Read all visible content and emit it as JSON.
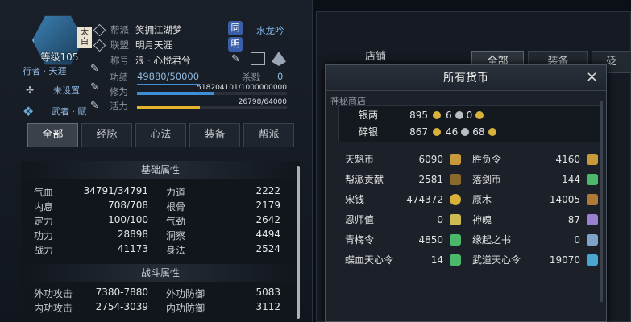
{
  "character": {
    "level": "等级105",
    "badge": "太白",
    "rows": [
      {
        "key": "帮派",
        "value": "笑拥江湖梦"
      },
      {
        "key": "联盟",
        "value": "明月天涯"
      },
      {
        "key": "称号",
        "value": "浪 · 心悦君兮"
      }
    ],
    "side_tags": [
      "同",
      "明"
    ],
    "side_text": "水龙吟",
    "roles": [
      {
        "label": "行者 · 天涯"
      },
      {
        "label": "未设置"
      },
      {
        "label": "武者 · 赋"
      }
    ],
    "stats": [
      {
        "key": "功绩",
        "value": "49880/50000",
        "extra_key": "杀戮",
        "extra": "0",
        "fill": 0.998
      },
      {
        "key": "修为",
        "value": "518204101/1000000000",
        "fill": 0.518
      },
      {
        "key": "活力",
        "value": "26798/64000",
        "fill": 0.419
      }
    ]
  },
  "tabs": [
    "全部",
    "经脉",
    "心法",
    "装备",
    "帮派"
  ],
  "sections": {
    "basic": {
      "title": "基础属性",
      "rows": [
        {
          "k1": "气血",
          "v1": "34791/34791",
          "k2": "力道",
          "v2": "2222"
        },
        {
          "k1": "内息",
          "v1": "708/708",
          "k2": "根骨",
          "v2": "2179"
        },
        {
          "k1": "定力",
          "v1": "100/100",
          "k2": "气劲",
          "v2": "2642"
        },
        {
          "k1": "功力",
          "v1": "28898",
          "k2": "洞察",
          "v2": "4494"
        },
        {
          "k1": "战力",
          "v1": "41173",
          "k2": "身法",
          "v2": "2524"
        }
      ]
    },
    "combat": {
      "title": "战斗属性",
      "rows": [
        {
          "k1": "外功攻击",
          "v1": "7380-7880",
          "k2": "外功防御",
          "v2": "5083"
        },
        {
          "k1": "内功攻击",
          "v1": "2754-3039",
          "k2": "内功防御",
          "v2": "3112"
        }
      ]
    }
  },
  "background": {
    "shop_label": "店铺",
    "tabs": [
      "全部",
      "装备",
      "砭"
    ],
    "sub": "神秘商店"
  },
  "dialog": {
    "title": "所有货币",
    "close": "×",
    "silver": {
      "label": "银两",
      "a": "895",
      "b": "6",
      "c": "0"
    },
    "broken_silver": {
      "label": "碎银",
      "a": "867",
      "b": "46",
      "c": "68"
    },
    "currencies": [
      {
        "n1": "天魁币",
        "v1": "6090",
        "n2": "胜负令",
        "v2": "4160"
      },
      {
        "n1": "帮派贡献",
        "v1": "2581",
        "n2": "落剑币",
        "v2": "144"
      },
      {
        "n1": "宋钱",
        "v1": "474372",
        "n2": "原木",
        "v2": "14005"
      },
      {
        "n1": "恩师值",
        "v1": "0",
        "n2": "神魄",
        "v2": "87"
      },
      {
        "n1": "青梅令",
        "v1": "4850",
        "n2": "缘起之书",
        "v2": "0"
      },
      {
        "n1": "蝶血天心令",
        "v1": "14",
        "n2": "武道天心令",
        "v2": "19070"
      }
    ]
  },
  "colors": {
    "gold": "#d8b13a",
    "silver": "#b9bdc4",
    "blue_bar": "#3e8fd6",
    "gold_bar": "#e3b52c",
    "green": "#4bb86a"
  }
}
